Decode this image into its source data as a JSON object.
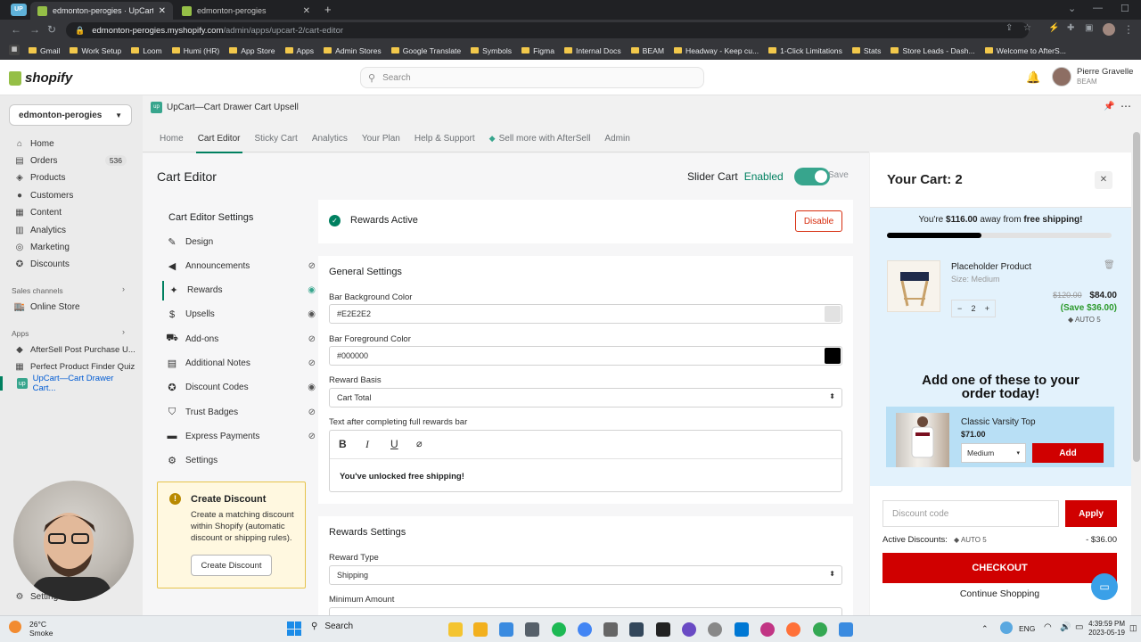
{
  "browser": {
    "tabs": [
      {
        "label": "edmonton-perogies · UpCart—C",
        "active": true
      },
      {
        "label": "edmonton-perogies",
        "active": false
      }
    ],
    "new_tab": "+",
    "url_host": "edmonton-perogies.myshopify.com",
    "url_path": "/admin/apps/upcart-2/cart-editor",
    "bookmarks": [
      "Gmail",
      "Work Setup",
      "Loom",
      "Humi (HR)",
      "App Store",
      "Apps",
      "Admin Stores",
      "Google Translate",
      "Symbols",
      "Figma",
      "Internal Docs",
      "BEAM",
      "Headway - Keep cu...",
      "1-Click Limitations",
      "Stats",
      "Store Leads - Dash...",
      "Welcome to AfterS..."
    ]
  },
  "shopify": {
    "logo": "shopify",
    "search_placeholder": "Search",
    "user_name": "Pierre Gravelle",
    "user_org": "BEAM",
    "store": "edmonton-perogies"
  },
  "sidebar": {
    "items": [
      {
        "label": "Home",
        "icon": "home-icon"
      },
      {
        "label": "Orders",
        "icon": "orders-icon",
        "badge": "536"
      },
      {
        "label": "Products",
        "icon": "tag-icon"
      },
      {
        "label": "Customers",
        "icon": "person-icon"
      },
      {
        "label": "Content",
        "icon": "content-icon"
      },
      {
        "label": "Analytics",
        "icon": "chart-icon"
      },
      {
        "label": "Marketing",
        "icon": "target-icon"
      },
      {
        "label": "Discounts",
        "icon": "discount-icon"
      }
    ],
    "sales_channels_title": "Sales channels",
    "online_store": "Online Store",
    "apps_title": "Apps",
    "apps": [
      "AfterSell Post Purchase U...",
      "Perfect Product Finder Quiz",
      "UpCart—Cart Drawer Cart..."
    ],
    "settings": "Settings"
  },
  "app": {
    "title": "UpCart—Cart Drawer Cart Upsell",
    "tabs": [
      "Home",
      "Cart Editor",
      "Sticky Cart",
      "Analytics",
      "Your Plan",
      "Help & Support",
      "Sell more with AfterSell",
      "Admin"
    ],
    "active_tab": "Cart Editor"
  },
  "editor": {
    "title": "Cart Editor",
    "slider_label": "Slider Cart",
    "slider_state": "Enabled",
    "save": "Save",
    "settings_title": "Cart Editor Settings",
    "menu": [
      {
        "label": "Design",
        "icon": "brush-icon",
        "eye": ""
      },
      {
        "label": "Announcements",
        "icon": "megaphone-icon",
        "eye": "hidden"
      },
      {
        "label": "Rewards",
        "icon": "rewards-icon",
        "eye": "visible",
        "active": true
      },
      {
        "label": "Upsells",
        "icon": "dollar-icon",
        "eye": "visible"
      },
      {
        "label": "Add-ons",
        "icon": "truck-icon",
        "eye": "hidden"
      },
      {
        "label": "Additional Notes",
        "icon": "note-icon",
        "eye": "hidden"
      },
      {
        "label": "Discount Codes",
        "icon": "discount-icon",
        "eye": "visible"
      },
      {
        "label": "Trust Badges",
        "icon": "shield-icon",
        "eye": "hidden"
      },
      {
        "label": "Express Payments",
        "icon": "card-icon",
        "eye": "hidden"
      },
      {
        "label": "Settings",
        "icon": "gear-icon",
        "eye": ""
      }
    ],
    "create_discount": {
      "title": "Create Discount",
      "body": "Create a matching discount within Shopify (automatic discount or shipping rules).",
      "button": "Create Discount"
    }
  },
  "rewards": {
    "status": "Rewards Active",
    "disable": "Disable",
    "general_title": "General Settings",
    "bg_label": "Bar Background Color",
    "bg_value": "#E2E2E2",
    "bg_color": "#E2E2E2",
    "fg_label": "Bar Foreground Color",
    "fg_value": "#000000",
    "fg_color": "#000000",
    "basis_label": "Reward Basis",
    "basis_value": "Cart Total",
    "text_label": "Text after completing full rewards bar",
    "text_value": "You've unlocked free shipping!",
    "rewards_title": "Rewards Settings",
    "type_label": "Reward Type",
    "type_value": "Shipping",
    "min_label": "Minimum Amount"
  },
  "cart": {
    "title": "Your Cart: 2",
    "progress_pre": "You're ",
    "progress_amount": "$116.00",
    "progress_mid": " away from ",
    "progress_goal": "free shipping!",
    "progress_fraction": 0.42,
    "item_name": "Placeholder Product",
    "item_variant": "Size: Medium",
    "item_orig_price": "$120.00",
    "item_price": "$84.00",
    "item_save": "(Save $36.00)",
    "item_discount": "AUTO 5",
    "qty": "2",
    "upsell_heading": "Add one of these to your order today!",
    "upsell_name": "Classic Varsity Top",
    "upsell_price": "$71.00",
    "upsell_variant": "Medium",
    "upsell_add": "Add",
    "discount_placeholder": "Discount code",
    "apply": "Apply",
    "active_discounts_label": "Active Discounts:",
    "active_code": "AUTO 5",
    "active_amount": "- $36.00",
    "checkout": "CHECKOUT",
    "continue": "Continue Shopping",
    "accent": "#D00000",
    "panel_bg": "#E3F2FC"
  },
  "taskbar": {
    "weather_temp": "26°C",
    "weather_desc": "Smoke",
    "search": "Search",
    "lang": "ENG",
    "time": "4:39:59 PM",
    "date": "2023-05-19"
  }
}
